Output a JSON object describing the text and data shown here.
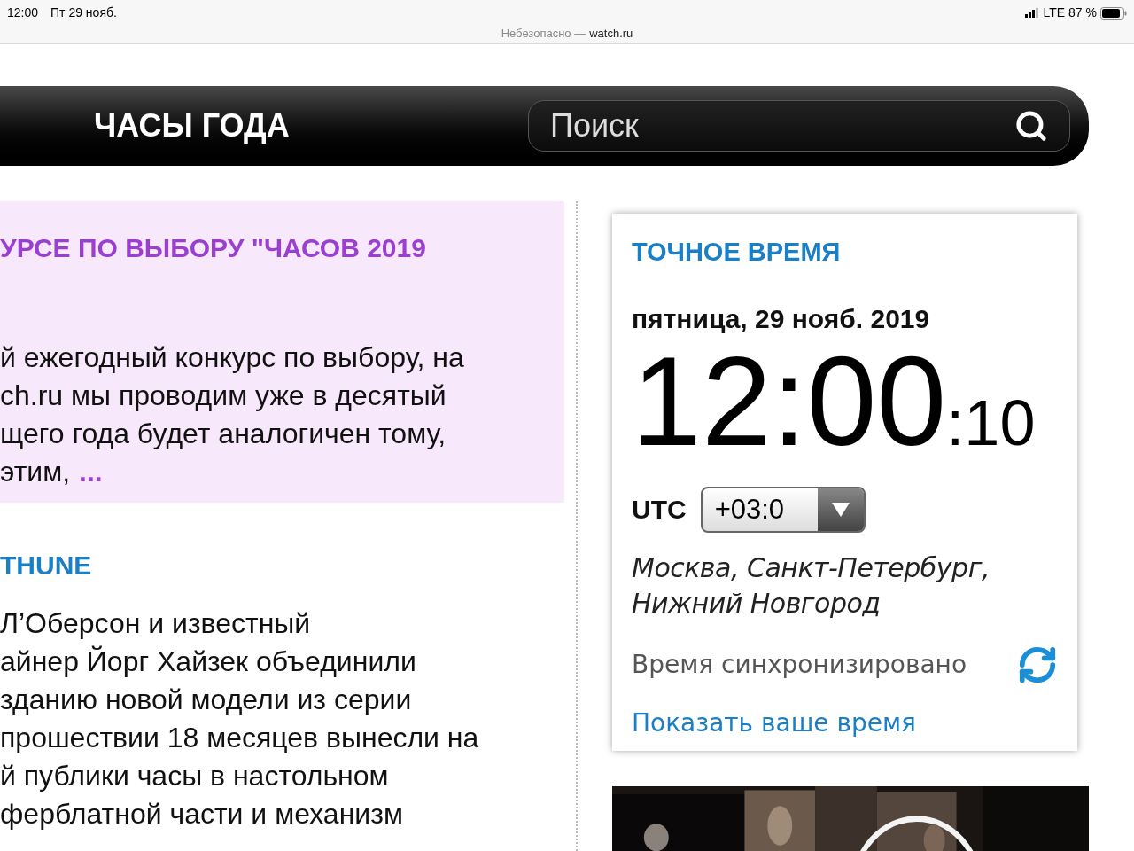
{
  "status_bar": {
    "time": "12:00",
    "date": "Пт 29 нояб.",
    "network": "LTE",
    "battery": "87 %"
  },
  "address_bar": {
    "security": "Небезопасно —",
    "domain": "watch.ru"
  },
  "header": {
    "logo": "ЧАСЫ ГОДА",
    "search": {
      "placeholder": "Поиск"
    }
  },
  "articles": [
    {
      "kind": "featured",
      "title": "УРСЕ ПО ВЫБОРУ \"ЧАСОВ 2019",
      "lines": [
        "й ежегодный конкурс по выбору, на",
        "ch.ru мы проводим уже в десятый",
        "щего года будет аналогичен тому,",
        "этим,"
      ],
      "more": "..."
    },
    {
      "kind": "plain",
      "title": "THUNE",
      "lines": [
        "Л’Оберсон и известный",
        "айнер Йорг Хайзек объединили",
        "зданию новой модели из серии",
        "прошествии 18 месяцев вынесли на",
        "й публики часы в настольном",
        "ферблатной части и механизм"
      ]
    }
  ],
  "time_widget": {
    "title": "ТОЧНОЕ ВРЕМЯ",
    "date": "пятница, 29 нояб. 2019",
    "hours_minutes": "12:00",
    "seconds": ":10",
    "utc_label": "UTC",
    "utc_offset": "+03:0",
    "cities": "Москва, Санкт-Петербург, Нижний Новгород",
    "sync_status": "Время синхронизировано",
    "show_time_link": "Показать ваше время"
  }
}
